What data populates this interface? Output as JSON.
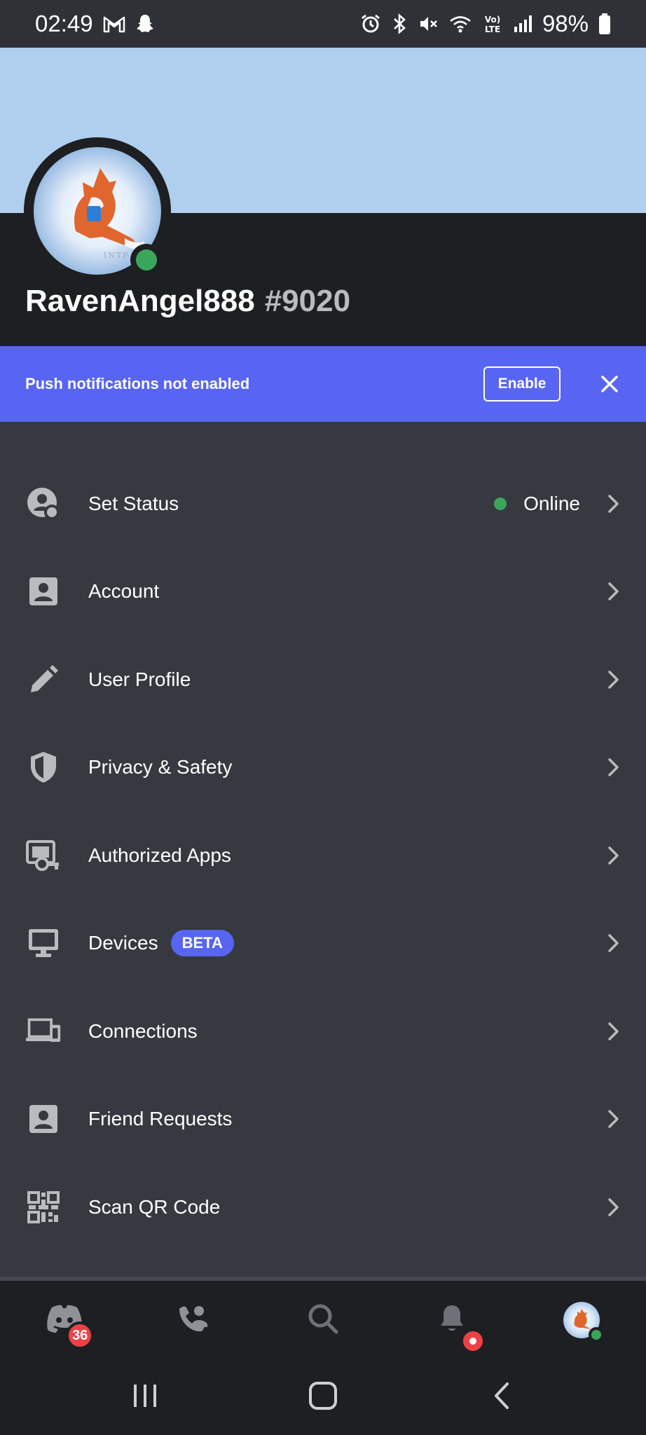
{
  "status_bar": {
    "time": "02:49",
    "battery": "98%",
    "icons": [
      "gmail-icon",
      "snapchat-icon",
      "alarm-icon",
      "bluetooth-icon",
      "mute-icon",
      "wifi-icon",
      "volte-icon",
      "signal-icon",
      "battery-icon"
    ]
  },
  "profile": {
    "username": "RavenAngel888",
    "discriminator": "#9020",
    "banner_color": "#b0cfee",
    "presence": "online",
    "avatar_text": "INTP"
  },
  "push_notice": {
    "text": "Push notifications not enabled",
    "enable_label": "Enable"
  },
  "menu": {
    "items": [
      {
        "label": "Set Status",
        "icon": "status-icon",
        "value": "Online"
      },
      {
        "label": "Account",
        "icon": "account-icon"
      },
      {
        "label": "User Profile",
        "icon": "pencil-icon"
      },
      {
        "label": "Privacy & Safety",
        "icon": "shield-icon"
      },
      {
        "label": "Authorized Apps",
        "icon": "authorized-apps-icon"
      },
      {
        "label": "Devices",
        "icon": "monitor-icon",
        "badge": "BETA"
      },
      {
        "label": "Connections",
        "icon": "connections-icon"
      },
      {
        "label": "Friend Requests",
        "icon": "friend-requests-icon"
      },
      {
        "label": "Scan QR Code",
        "icon": "qr-code-icon"
      }
    ]
  },
  "bottom_nav": {
    "home_badge": "36",
    "items": [
      "home-icon",
      "friends-icon",
      "search-icon",
      "notifications-icon",
      "profile-avatar"
    ]
  },
  "colors": {
    "accent": "#5865f2",
    "online": "#3ba55c",
    "danger": "#ed4245",
    "background": "#36393f"
  }
}
